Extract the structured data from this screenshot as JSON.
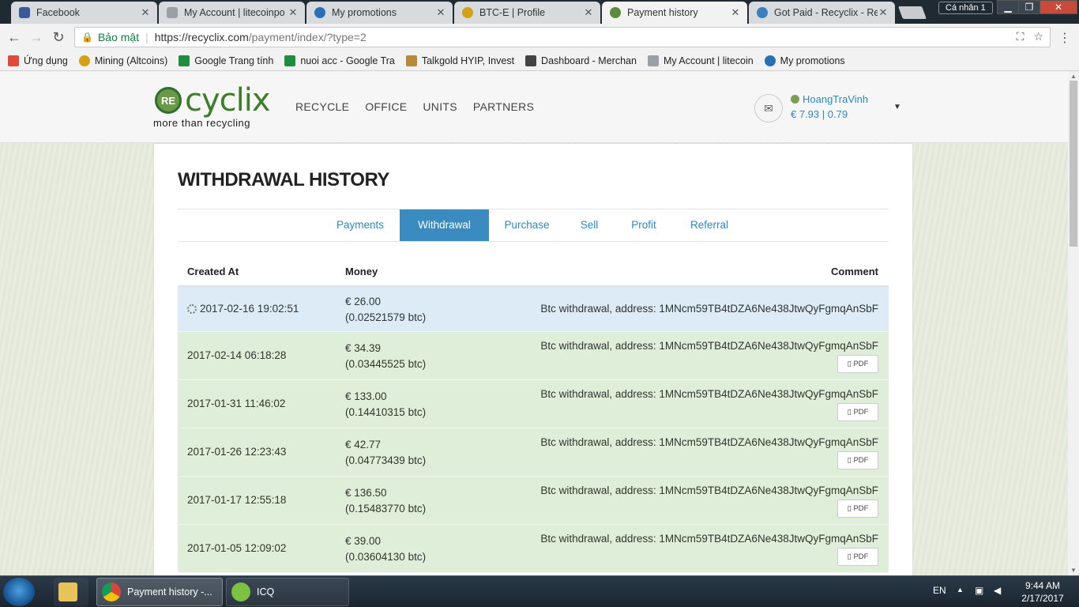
{
  "browser": {
    "tabs": [
      {
        "title": "Facebook",
        "color": "#3b5998"
      },
      {
        "title": "My Account | litecoinpo",
        "color": "#9aa0a6"
      },
      {
        "title": "My promotions",
        "color": "#2a6fb5"
      },
      {
        "title": "BTC-E | Profile",
        "color": "#d4a017"
      },
      {
        "title": "Payment history",
        "color": "#5a8a3a"
      },
      {
        "title": "Got Paid - Recyclix - Re",
        "color": "#3a7fc0"
      }
    ],
    "profile": "Cá nhân 1",
    "secure_label": "Bảo mật",
    "url_base": "https://recyclix.com",
    "url_path": "/payment/index/?type=2",
    "bookmarks": [
      {
        "label": "Ứng dụng",
        "color": "#e04a3a"
      },
      {
        "label": "Mining (Altcoins)",
        "color": "#d4a017"
      },
      {
        "label": "Google Trang tính",
        "color": "#1e8e3e"
      },
      {
        "label": "nuoi acc - Google Tra",
        "color": "#1e8e3e"
      },
      {
        "label": "Talkgold HYIP, Invest",
        "color": "#b58a3a"
      },
      {
        "label": "Dashboard - Merchan",
        "color": "#444444"
      },
      {
        "label": "My Account | litecoin",
        "color": "#9aa0a6"
      },
      {
        "label": "My promotions",
        "color": "#2a6fb5"
      }
    ]
  },
  "site": {
    "logo_mark": "RE",
    "logo_text": "cyclix",
    "tagline": "more than recycling",
    "nav": [
      "RECYCLE",
      "OFFICE",
      "UNITS",
      "PARTNERS"
    ],
    "user": {
      "name": "HoangTraVinh",
      "balance": "€ 7.93 | 0.79"
    }
  },
  "main": {
    "title": "WITHDRAWAL HISTORY",
    "tabs": [
      "Payments",
      "Withdrawal",
      "Purchase",
      "Sell",
      "Profit",
      "Referral"
    ],
    "active_tab": "Withdrawal",
    "columns": [
      "Created At",
      "Money",
      "Comment"
    ],
    "pdf_label": "PDF",
    "rows": [
      {
        "date": "2017-02-16 19:02:51",
        "eur": "€ 26.00",
        "btc": "(0.02521579 btc)",
        "comment": "Btc withdrawal, address: 1MNcm59TB4tDZA6Ne438JtwQyFgmqAnSbF",
        "pending": true
      },
      {
        "date": "2017-02-14 06:18:28",
        "eur": "€ 34.39",
        "btc": "(0.03445525 btc)",
        "comment": "Btc withdrawal, address: 1MNcm59TB4tDZA6Ne438JtwQyFgmqAnSbF",
        "pending": false
      },
      {
        "date": "2017-01-31 11:46:02",
        "eur": "€ 133.00",
        "btc": "(0.14410315 btc)",
        "comment": "Btc withdrawal, address: 1MNcm59TB4tDZA6Ne438JtwQyFgmqAnSbF",
        "pending": false
      },
      {
        "date": "2017-01-26 12:23:43",
        "eur": "€ 42.77",
        "btc": "(0.04773439 btc)",
        "comment": "Btc withdrawal, address: 1MNcm59TB4tDZA6Ne438JtwQyFgmqAnSbF",
        "pending": false
      },
      {
        "date": "2017-01-17 12:55:18",
        "eur": "€ 136.50",
        "btc": "(0.15483770 btc)",
        "comment": "Btc withdrawal, address: 1MNcm59TB4tDZA6Ne438JtwQyFgmqAnSbF",
        "pending": false
      },
      {
        "date": "2017-01-05 12:09:02",
        "eur": "€ 39.00",
        "btc": "(0.03604130 btc)",
        "comment": "Btc withdrawal, address: 1MNcm59TB4tDZA6Ne438JtwQyFgmqAnSbF",
        "pending": false
      }
    ]
  },
  "taskbar": {
    "items": [
      "Payment history -...",
      "ICQ"
    ],
    "lang": "EN",
    "time": "9:44 AM",
    "date": "2/17/2017"
  }
}
